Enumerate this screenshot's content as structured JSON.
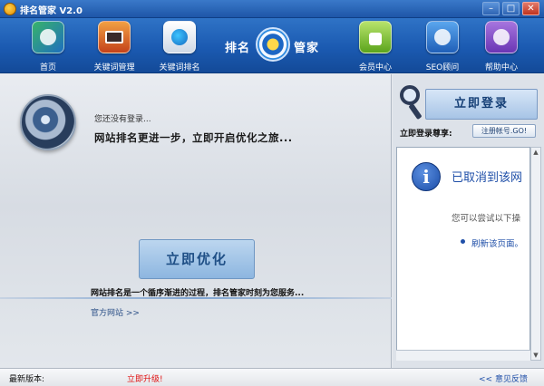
{
  "window": {
    "title": "排名管家 V2.0",
    "minimize_glyph": "–",
    "maximize_glyph": "□",
    "close_glyph": "✕"
  },
  "nav": {
    "items": [
      {
        "label": "首页",
        "icon": "home-icon"
      },
      {
        "label": "关键词管理",
        "icon": "keyword-manage-icon"
      },
      {
        "label": "关键词排名",
        "icon": "keyword-rank-icon"
      },
      {
        "label": "会员中心",
        "icon": "member-center-icon"
      },
      {
        "label": "SEO顾问",
        "icon": "seo-advisor-icon"
      },
      {
        "label": "帮助中心",
        "icon": "help-center-icon"
      }
    ],
    "brand_left": "排名",
    "brand_right": "管家"
  },
  "main": {
    "not_logged_in": "您还没有登录...",
    "slogan": "网站排名更进一步，立即开启优化之旅...",
    "optimize_button": "立即优化",
    "tagline": "网站排名是一个循序渐进的过程，排名管家时刻为您服务...",
    "official_site": "官方网站 >>"
  },
  "right": {
    "login_button": "立即登录",
    "login_hint": "立即登录尊享:",
    "register_button": "注册帐号.GO!",
    "webview": {
      "title": "已取消到该网",
      "subtitle": "您可以尝试以下操",
      "link": "刷新该页面。"
    }
  },
  "status": {
    "version_label": "最新版本:",
    "upgrade_link": "立即升级!",
    "feedback_link": "<< 意见反馈"
  },
  "colors": {
    "header_blue": "#1b5ab1",
    "accent_link": "#1f4fa8",
    "upgrade_red": "#e01010"
  }
}
